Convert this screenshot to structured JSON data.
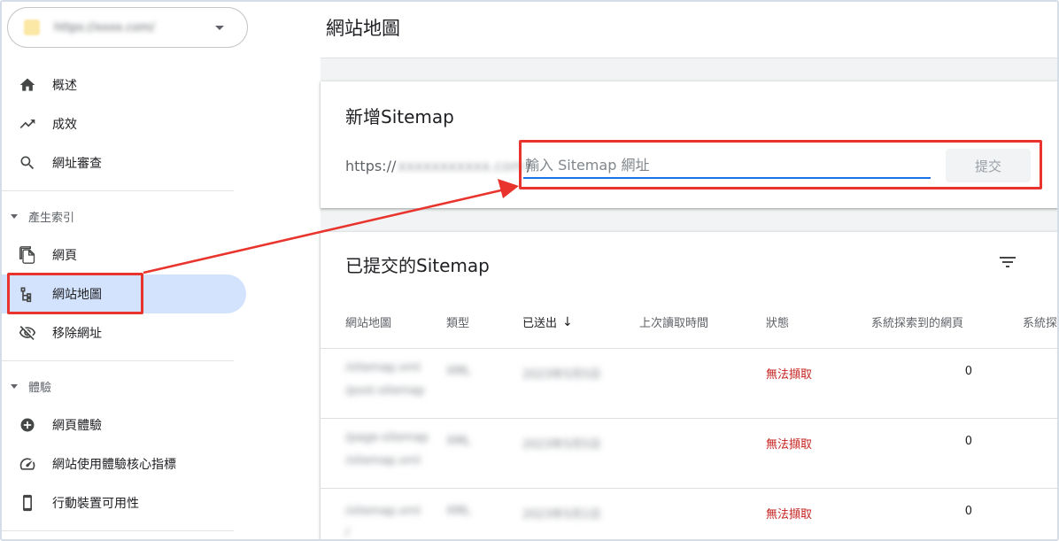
{
  "property": {
    "url": "https://xxxx.com/"
  },
  "nav": {
    "overview": "概述",
    "performance": "成效",
    "url_inspection": "網址審查",
    "section_indexing": "產生索引",
    "pages": "網頁",
    "sitemaps": "網站地圖",
    "removals": "移除網址",
    "section_experience": "體驗",
    "page_experience": "網頁體驗",
    "core_web_vitals": "網站使用體驗核心指標",
    "mobile_usability": "行動裝置可用性"
  },
  "header": {
    "title": "網站地圖"
  },
  "add_sitemap": {
    "title": "新增Sitemap",
    "url_prefix": "https://",
    "url_domain": "xxxxxxxxxxx.com",
    "slash": "/",
    "placeholder": "輸入 Sitemap 網址",
    "submit_label": "提交"
  },
  "submitted": {
    "title": "已提交的Sitemap",
    "columns": {
      "sitemap": "網站地圖",
      "type": "類型",
      "submitted": "已送出",
      "last_read": "上次讀取時間",
      "status": "狀態",
      "discovered": "系統探索到的網頁",
      "discovered_cut": "系統探"
    },
    "sort_arrow": "↓",
    "rows": [
      {
        "sitemap_line1": "/sitemap.xml",
        "sitemap_line2": "/post-sitemap",
        "type": "XML",
        "submitted": "2023年5月5日",
        "status": "無法擷取",
        "discovered": "0"
      },
      {
        "sitemap_line1": "/page-sitemap",
        "sitemap_line2": "/sitemap.xml",
        "type": "XML",
        "submitted": "2023年5月5日",
        "status": "無法擷取",
        "discovered": "0"
      },
      {
        "sitemap_line1": "/sitemap.xml",
        "sitemap_line2": "/",
        "type": "XML",
        "submitted": "2023年5月1日",
        "status": "無法擷取",
        "discovered": "0"
      }
    ]
  },
  "colors": {
    "accent": "#1a73e8",
    "active_nav": "#d3e3fd",
    "error": "#c5221f",
    "annotation": "#e8342c"
  }
}
